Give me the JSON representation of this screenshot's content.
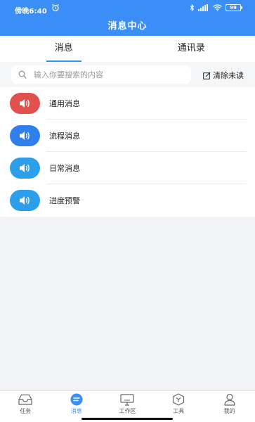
{
  "status_bar": {
    "time": "傍晚6:40",
    "battery": "99"
  },
  "header": {
    "title": "消息中心"
  },
  "tabs": [
    {
      "label": "消息",
      "active": true
    },
    {
      "label": "通讯录",
      "active": false
    }
  ],
  "search": {
    "placeholder": "输入你要搜索的内容",
    "value": ""
  },
  "clear_unread_label": "清除未读",
  "messages": [
    {
      "label": "通用消息",
      "icon": "speaker-icon",
      "color": "#e0514d"
    },
    {
      "label": "流程消息",
      "icon": "speaker-icon",
      "color": "#2f80ec"
    },
    {
      "label": "日常消息",
      "icon": "speaker-icon",
      "color": "#2d9eea"
    },
    {
      "label": "进度预警",
      "icon": "speaker-icon",
      "color": "#2d9eea"
    }
  ],
  "bottom_nav": [
    {
      "label": "任务",
      "icon": "inbox-icon",
      "active": false
    },
    {
      "label": "消息",
      "icon": "message-icon",
      "active": true
    },
    {
      "label": "工作区",
      "icon": "monitor-icon",
      "active": false
    },
    {
      "label": "工具",
      "icon": "toolbox-icon",
      "active": false
    },
    {
      "label": "我的",
      "icon": "user-icon",
      "active": false
    }
  ],
  "colors": {
    "primary": "#3a8ef6",
    "background": "#f2f3f7"
  }
}
